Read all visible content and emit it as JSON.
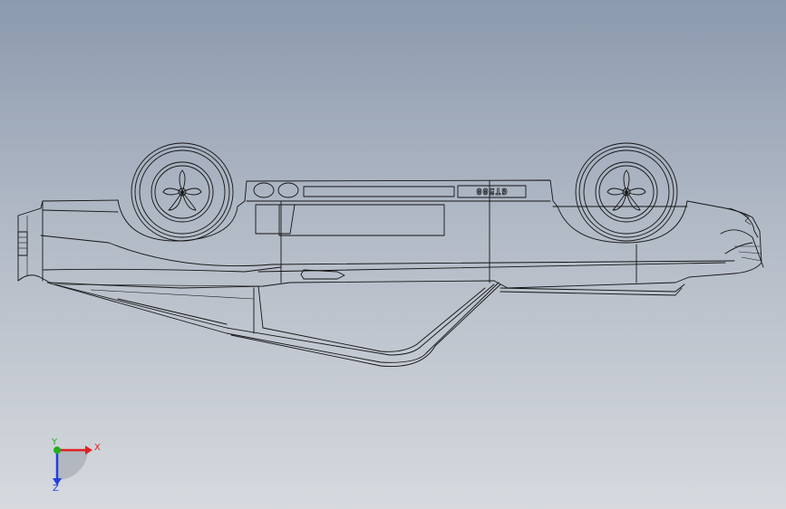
{
  "model": {
    "badge_text": "GT500"
  },
  "triad": {
    "x_label": "X",
    "y_label": "Y",
    "z_label": "Z",
    "x_color": "#e02020",
    "y_color": "#20b020",
    "z_color": "#2040e0"
  },
  "colors": {
    "line": "#141414",
    "background_top": "#8c9aae",
    "background_bottom": "#d6d9de"
  }
}
